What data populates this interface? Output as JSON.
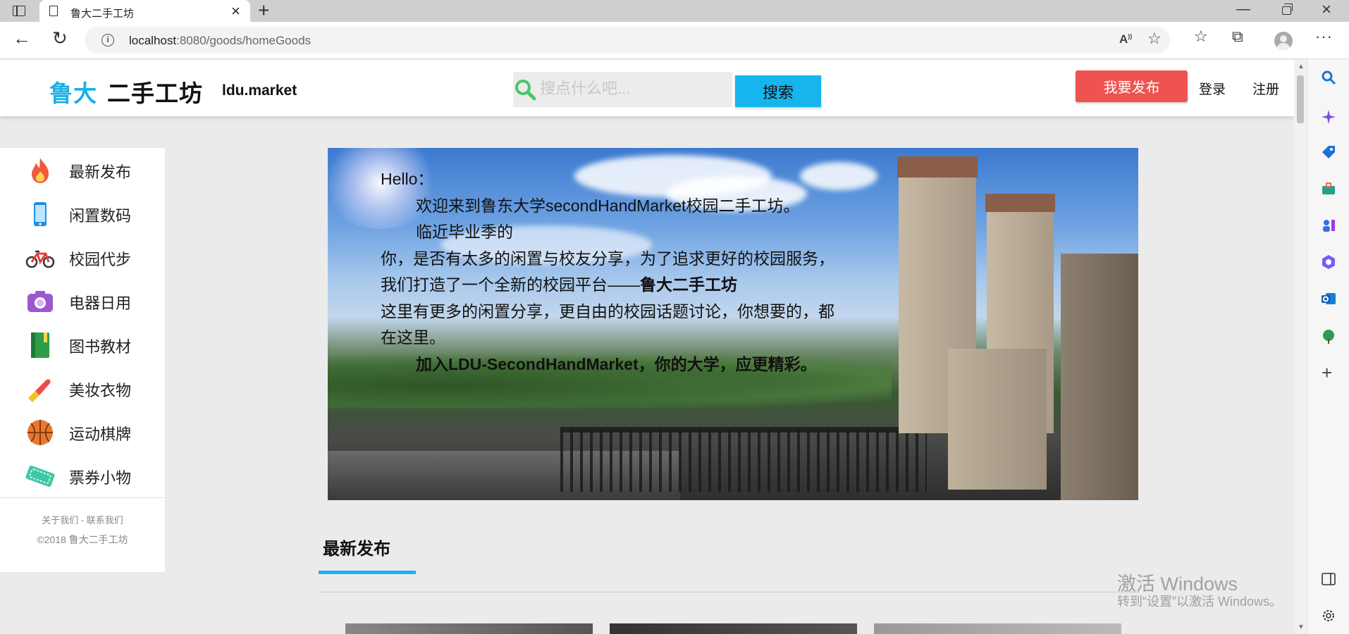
{
  "browser": {
    "tab_title": "鲁大二手工坊",
    "url_host": "localhost",
    "url_path": ":8080/goods/homeGoods"
  },
  "header": {
    "logo_main": "鲁大",
    "logo_rest": "二手工坊",
    "logo_sub": "ldu.market",
    "search_placeholder": "搜点什么吧...",
    "search_button": "搜索",
    "publish_button": "我要发布",
    "login": "登录",
    "register": "注册"
  },
  "sidebar": {
    "items": [
      {
        "label": "最新发布",
        "icon": "fire-icon"
      },
      {
        "label": "闲置数码",
        "icon": "phone-icon"
      },
      {
        "label": "校园代步",
        "icon": "bicycle-icon"
      },
      {
        "label": "电器日用",
        "icon": "camera-icon"
      },
      {
        "label": "图书教材",
        "icon": "book-icon"
      },
      {
        "label": "美妆衣物",
        "icon": "lipstick-icon"
      },
      {
        "label": "运动棋牌",
        "icon": "basketball-icon"
      },
      {
        "label": "票券小物",
        "icon": "ticket-icon"
      }
    ],
    "footer_links": "关于我们 - 联系我们",
    "copyright": "©2018 鲁大二手工坊"
  },
  "banner": {
    "hello": "Hello：",
    "line1": "欢迎来到鲁东大学secondHandMarket校园二手工坊。",
    "line2": "临近毕业季的",
    "line3a": "你，是否有太多的闲置与校友分享，为了追求更好的校园服务，我们打造了一个全新的校园平台——",
    "line3b": "鲁大二手工坊",
    "line4": "这里有更多的闲置分享，更自由的校园话题讨论，你想要的，都在这里。",
    "line5": "加入LDU-SecondHandMarket，你的大学，应更精彩。"
  },
  "section": {
    "title": "最新发布"
  },
  "watermark": {
    "line1": "激活 Windows",
    "line2": "转到“设置”以激活 Windows。"
  },
  "colors": {
    "accent": "#16b5ee",
    "publish": "#ef5350"
  }
}
